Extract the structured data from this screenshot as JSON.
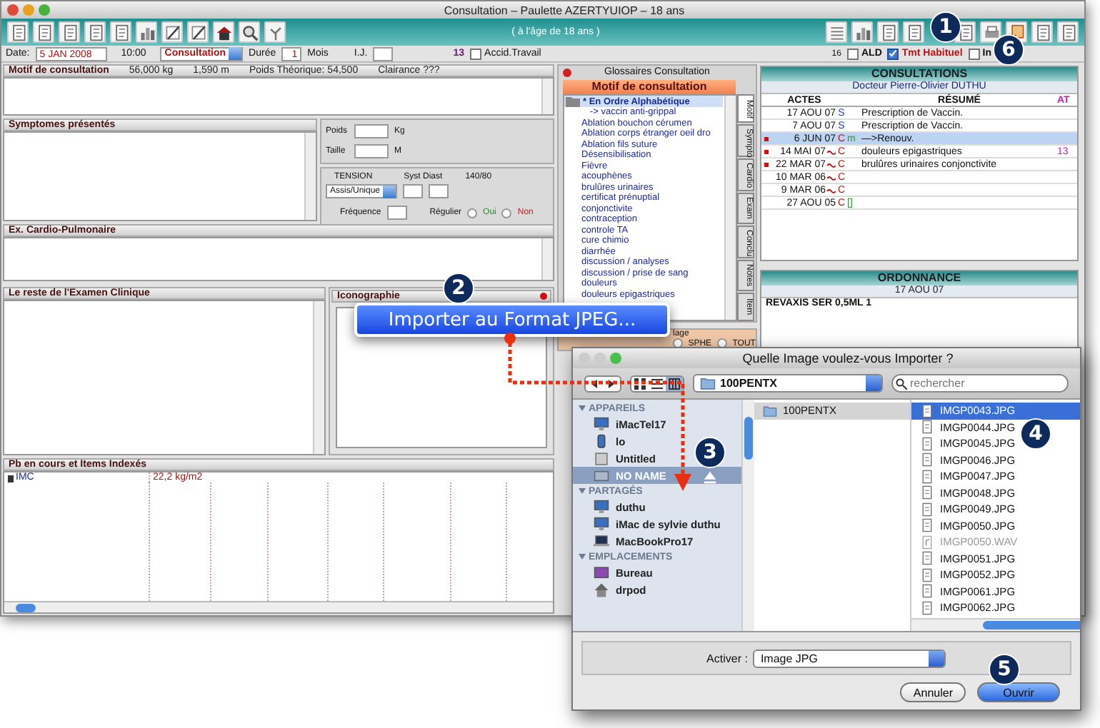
{
  "window": {
    "title": "Consultation – Paulette AZERTYUIOP – 18 ans",
    "age_note": "( à l'âge de 18 ans )"
  },
  "header": {
    "date_label": "Date:",
    "date": "5 JAN 2008",
    "time": "10:00",
    "type": "Consultation",
    "duration_label": "Durée",
    "duration": "1",
    "duration_unit": "Mois",
    "ij_label": "I.J.",
    "count": "13",
    "accident": {
      "label": "Accid.Travail",
      "checked": false
    }
  },
  "options": {
    "font_size": "16",
    "checkboxes": [
      {
        "label": "ALD",
        "checked": false
      },
      {
        "label": "Tmt Habituel",
        "checked": true
      },
      {
        "label": "In",
        "checked": false
      }
    ]
  },
  "motif": {
    "title": "Motif de consultation",
    "metrics": [
      "56,000 kg",
      "1,590 m",
      "Poids Théorique: 54,500",
      "Clairance ???"
    ]
  },
  "symptoms": {
    "title": "Symptomes présentés"
  },
  "vitals": {
    "weight_label": "Poids",
    "weight_unit": "Kg",
    "height_label": "Taille",
    "height_unit": "M",
    "tension_label": "TENSION",
    "syst_diast_label": "Syst Diast",
    "tension_reading": "140/80",
    "position": "Assis/Unique",
    "frequency_label": "Fréquence",
    "regular_label": "Régulier",
    "regular_options": [
      {
        "label": "Oui",
        "selected": false,
        "color": "#2a8a2a"
      },
      {
        "label": "Non",
        "selected": false,
        "color": "#c02020"
      }
    ]
  },
  "cardio": {
    "title": "Ex. Cardio-Pulmonaire"
  },
  "exam": {
    "title": "Le reste de l'Examen Clinique"
  },
  "iconography": {
    "title": "Iconographie"
  },
  "problems": {
    "title": "Pb en cours et Items Indexés",
    "rows": [
      {
        "name": "IMC",
        "value": "22,2 kg/m2"
      }
    ]
  },
  "glossary": {
    "title": "Glossaires Consultation",
    "category": "Motif de consultation",
    "root": {
      "label": "* En Ordre Alphabétique",
      "selected": true,
      "children": [
        {
          "label": "-> vaccin anti-grippal",
          "selected": false
        },
        {
          "label": "Ablation bouchon cérumen",
          "selected": false
        },
        {
          "label": "Ablation corps étranger oeil dro",
          "selected": false
        },
        {
          "label": "Ablation fils suture",
          "selected": false
        },
        {
          "label": "Désensibilisation",
          "selected": false
        },
        {
          "label": "Fièvre",
          "selected": false
        },
        {
          "label": "acouphènes",
          "selected": false
        },
        {
          "label": "brulûres urinaires",
          "selected": false
        },
        {
          "label": "certificat prénuptial",
          "selected": false
        },
        {
          "label": "conjonctivite",
          "selected": false
        },
        {
          "label": "contraception",
          "selected": false
        },
        {
          "label": "controle TA",
          "selected": false
        },
        {
          "label": "cure chimio",
          "selected": false
        },
        {
          "label": "diarrhée",
          "selected": false
        },
        {
          "label": "discussion / analyses",
          "selected": false
        },
        {
          "label": "discussion / prise de sang",
          "selected": false
        },
        {
          "label": "douleurs",
          "selected": false
        },
        {
          "label": "douleurs epigastriques",
          "selected": false
        }
      ]
    },
    "tabs": [
      {
        "label": "Motif",
        "selected": true
      },
      {
        "label": "Sympto",
        "selected": false
      },
      {
        "label": "Cardio",
        "selected": false
      },
      {
        "label": "Exam",
        "selected": false
      },
      {
        "label": "Conclu",
        "selected": false
      },
      {
        "label": "Notes",
        "selected": false
      },
      {
        "label": "Item",
        "selected": false
      }
    ],
    "bottom_label": "lage",
    "radios": [
      {
        "label": "SPHE",
        "selected": false
      },
      {
        "label": "TOUT",
        "selected": false
      }
    ]
  },
  "consultations": {
    "title": "CONSULTATIONS",
    "doctor": "Docteur Pierre-Olivier DUTHU",
    "columns": [
      "ACTES",
      "RÉSUMÉ",
      "AT"
    ],
    "rows": [
      {
        "date": "17 AOU 07",
        "type": "S",
        "note": "",
        "summary": "Prescription de Vaccin.",
        "at": "",
        "selected": false,
        "flagged": false,
        "linked": false
      },
      {
        "date": "7 AOU 07",
        "type": "S",
        "note": "",
        "summary": "Prescription de Vaccin.",
        "at": "",
        "selected": false,
        "flagged": false,
        "linked": false
      },
      {
        "date": "6 JUN 07",
        "type": "C",
        "note": "m",
        "summary": "—>Renouv.",
        "at": "",
        "selected": true,
        "flagged": true,
        "linked": false
      },
      {
        "date": "14 MAI 07",
        "type": "C",
        "note": "",
        "summary": "douleurs epigastriques",
        "at": "13",
        "selected": false,
        "flagged": true,
        "linked": true
      },
      {
        "date": "22 MAR 07",
        "type": "C",
        "note": "",
        "summary": "brulûres urinaires conjonctivite",
        "at": "",
        "selected": false,
        "flagged": true,
        "linked": true
      },
      {
        "date": "10 MAR 06",
        "type": "C",
        "note": "",
        "summary": "",
        "at": "",
        "selected": false,
        "flagged": false,
        "linked": true
      },
      {
        "date": "9 MAR 06",
        "type": "C",
        "note": "",
        "summary": "",
        "at": "",
        "selected": false,
        "flagged": false,
        "linked": true
      },
      {
        "date": "27 AOU 05",
        "type": "C",
        "note": "[]",
        "summary": "",
        "at": "",
        "selected": false,
        "flagged": false,
        "linked": false
      }
    ]
  },
  "prescription": {
    "title": "ORDONNANCE",
    "date": "17 AOU 07",
    "items": [
      "REVAXIS SER 0,5ML 1"
    ]
  },
  "context_menu": {
    "items": [
      {
        "label": "Importer au Format JPEG...",
        "selected": true
      }
    ]
  },
  "dialog": {
    "title": "Quelle Image voulez-vous Importer ?",
    "location": "100PENTX",
    "search_placeholder": "rechercher",
    "sidebar": [
      {
        "heading": "APPAREILS",
        "items": [
          {
            "label": "iMacTel17",
            "kind": "computer",
            "selected": false
          },
          {
            "label": "lo",
            "kind": "disk",
            "selected": false
          },
          {
            "label": "Untitled",
            "kind": "drive",
            "selected": false
          },
          {
            "label": "NO NAME",
            "kind": "volume",
            "selected": true,
            "ejectable": true
          }
        ]
      },
      {
        "heading": "PARTAGÉS",
        "items": [
          {
            "label": "duthu",
            "kind": "computer",
            "selected": false
          },
          {
            "label": "iMac de sylvie duthu",
            "kind": "computer",
            "selected": false
          },
          {
            "label": "MacBookPro17",
            "kind": "laptop",
            "selected": false
          }
        ]
      },
      {
        "heading": "EMPLACEMENTS",
        "items": [
          {
            "label": "Bureau",
            "kind": "desktop",
            "selected": false
          },
          {
            "label": "drpod",
            "kind": "home",
            "selected": false
          }
        ]
      }
    ],
    "columns": [
      [
        {
          "label": "100PENTX",
          "kind": "folder",
          "selected": true,
          "disabled": false
        }
      ],
      [
        {
          "label": "IMGP0043.JPG",
          "kind": "file",
          "selected": true,
          "disabled": false
        },
        {
          "label": "IMGP0044.JPG",
          "kind": "file",
          "selected": false,
          "disabled": false
        },
        {
          "label": "IMGP0045.JPG",
          "kind": "file",
          "selected": false,
          "disabled": false
        },
        {
          "label": "IMGP0046.JPG",
          "kind": "file",
          "selected": false,
          "disabled": false
        },
        {
          "label": "IMGP0047.JPG",
          "kind": "file",
          "selected": false,
          "disabled": false
        },
        {
          "label": "IMGP0048.JPG",
          "kind": "file",
          "selected": false,
          "disabled": false
        },
        {
          "label": "IMGP0049.JPG",
          "kind": "file",
          "selected": false,
          "disabled": false
        },
        {
          "label": "IMGP0050.JPG",
          "kind": "file",
          "selected": false,
          "disabled": false
        },
        {
          "label": "IMGP0050.WAV",
          "kind": "audio",
          "selected": false,
          "disabled": true
        },
        {
          "label": "IMGP0051.JPG",
          "kind": "file",
          "selected": false,
          "disabled": false
        },
        {
          "label": "IMGP0052.JPG",
          "kind": "file",
          "selected": false,
          "disabled": false
        },
        {
          "label": "IMGP0061.JPG",
          "kind": "file",
          "selected": false,
          "disabled": false
        },
        {
          "label": "IMGP0062.JPG",
          "kind": "file",
          "selected": false,
          "disabled": false
        }
      ]
    ],
    "format_label": "Activer :",
    "format": "Image JPG",
    "buttons": [
      {
        "label": "Annuler",
        "default": false
      },
      {
        "label": "Ouvrir",
        "default": true
      }
    ]
  },
  "callouts": [
    "1",
    "2",
    "3",
    "4",
    "5",
    "6"
  ]
}
